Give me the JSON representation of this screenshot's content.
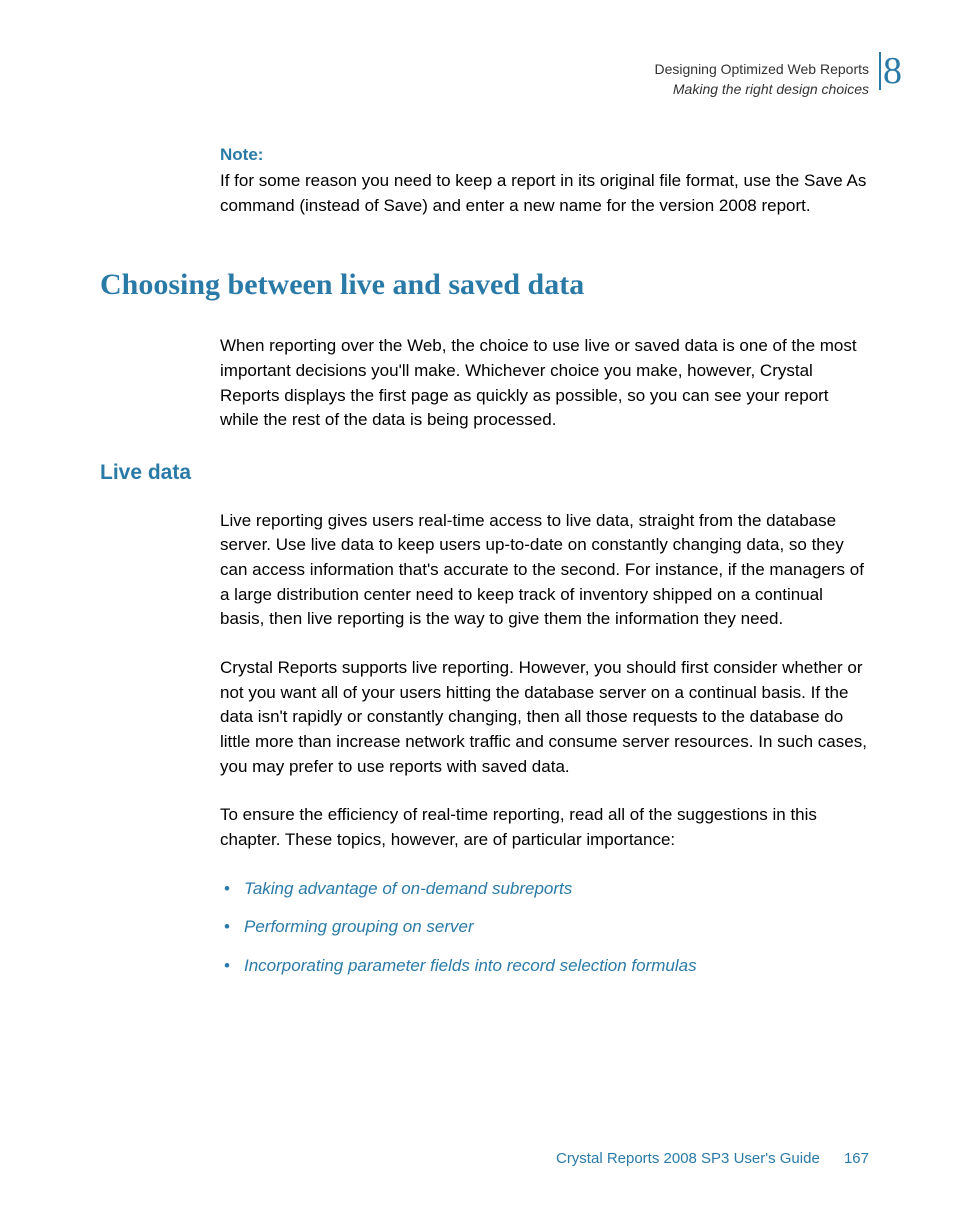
{
  "header": {
    "chapter_title": "Designing Optimized Web Reports",
    "section_title": "Making the right design choices",
    "chapter_number": "8"
  },
  "note": {
    "label": "Note:",
    "text": "If for some reason you need to keep a report in its original file format, use the Save As command (instead of Save) and enter a new name for the version 2008 report."
  },
  "h1": "Choosing between live and saved data",
  "intro_para": "When reporting over the Web, the choice to use live or saved data is one of the most important decisions you'll make. Whichever choice you make, however, Crystal Reports displays the first page as quickly as possible, so you can see your report while the rest of the data is being processed.",
  "h2": "Live data",
  "live_para1": "Live reporting gives users real-time access to live data, straight from the database server. Use live data to keep users up-to-date on constantly changing data, so they can access information that's accurate to the second. For instance, if the managers of a large distribution center need to keep track of inventory shipped on a continual basis, then live reporting is the way to give them the information they need.",
  "live_para2": "Crystal Reports supports live reporting. However, you should first consider whether or not you want all of your users hitting the database server on a continual basis. If the data isn't rapidly or constantly changing, then all those requests to the database do little more than increase network traffic and consume server resources. In such cases, you may prefer to use reports with saved data.",
  "live_para3": "To ensure the efficiency of real-time reporting, read all of the suggestions in this chapter. These topics, however, are of particular importance:",
  "links": {
    "item1": "Taking advantage of on-demand subreports",
    "item2": "Performing grouping on server",
    "item3": "Incorporating parameter fields into record selection formulas"
  },
  "footer": {
    "guide": "Crystal Reports 2008 SP3 User's Guide",
    "page": "167"
  }
}
